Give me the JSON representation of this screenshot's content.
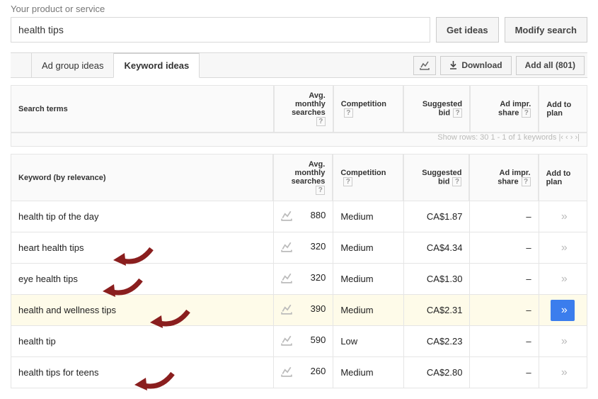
{
  "input": {
    "label": "Your product or service",
    "value": "health tips",
    "get_ideas": "Get ideas",
    "modify_search": "Modify search"
  },
  "tabs": {
    "ad_group": "Ad group ideas",
    "keyword": "Keyword ideas",
    "download": "Download",
    "add_all": "Add all (801)"
  },
  "headers": {
    "search_terms": "Search terms",
    "avg_monthly": "Avg. monthly searches",
    "competition": "Competition",
    "suggested_bid": "Suggested bid",
    "ad_impr": "Ad impr. share",
    "add_to_plan": "Add to plan",
    "keyword_relevance": "Keyword (by relevance)",
    "pager_text": "Show rows:   30     1 - 1 of 1 keywords      |‹    ‹    ›    ›|"
  },
  "rows": [
    {
      "keyword": "health tip of the day",
      "searches": "880",
      "competition": "Medium",
      "bid": "CA$1.87",
      "impr": "–",
      "arrow": false,
      "highlight": false
    },
    {
      "keyword": "heart health tips",
      "searches": "320",
      "competition": "Medium",
      "bid": "CA$4.34",
      "impr": "–",
      "arrow": true,
      "highlight": false
    },
    {
      "keyword": "eye health tips",
      "searches": "320",
      "competition": "Medium",
      "bid": "CA$1.30",
      "impr": "–",
      "arrow": true,
      "highlight": false
    },
    {
      "keyword": "health and wellness tips",
      "searches": "390",
      "competition": "Medium",
      "bid": "CA$2.31",
      "impr": "–",
      "arrow": true,
      "highlight": true
    },
    {
      "keyword": "health tip",
      "searches": "590",
      "competition": "Low",
      "bid": "CA$2.23",
      "impr": "–",
      "arrow": false,
      "highlight": false
    },
    {
      "keyword": "health tips for teens",
      "searches": "260",
      "competition": "Medium",
      "bid": "CA$2.80",
      "impr": "–",
      "arrow": true,
      "highlight": false
    }
  ]
}
